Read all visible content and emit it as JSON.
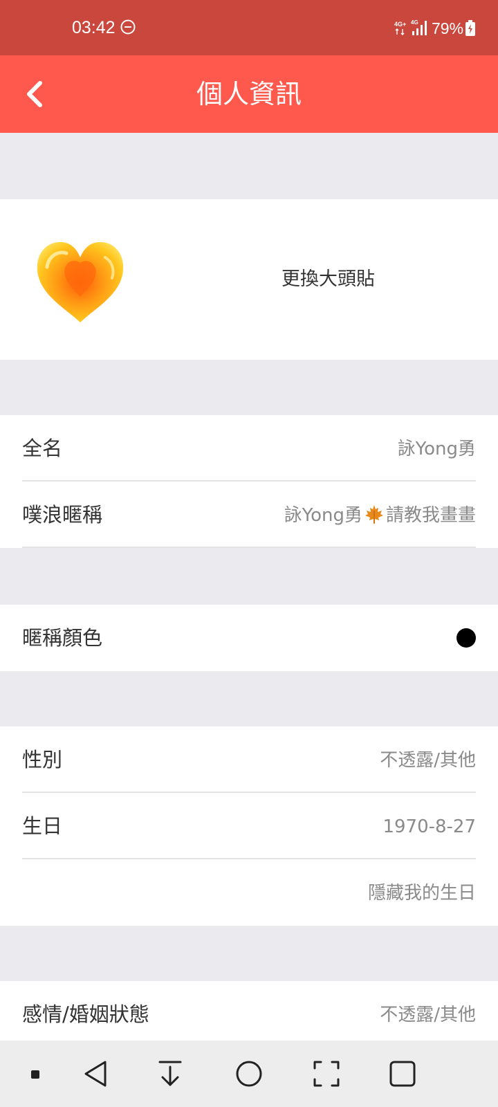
{
  "status_bar": {
    "time": "03:42",
    "network_badge": "4G+",
    "signal_badge": "4G",
    "battery_percent": "79%"
  },
  "header": {
    "title": "個人資訊",
    "background_color": "#ff584c"
  },
  "avatar_section": {
    "change_avatar_label": "更換大頭貼"
  },
  "name_section": {
    "full_name_label": "全名",
    "full_name_value": "詠Yong勇",
    "nickname_label": "噗浪暱稱",
    "nickname_value_part1": "詠Yong勇",
    "nickname_value_part2": "請教我畫畫"
  },
  "color_section": {
    "nickname_color_label": "暱稱顏色",
    "nickname_color": "#000000"
  },
  "personal_section": {
    "gender_label": "性別",
    "gender_value": "不透露/其他",
    "birthday_label": "生日",
    "birthday_value": "1970-8-27",
    "hide_birthday_label": "隱藏我的生日"
  },
  "relationship_section": {
    "relationship_label": "感情/婚姻狀態",
    "relationship_value": "不透露/其他"
  },
  "icons": {
    "back": "chevron-left-icon",
    "dnd": "do-not-disturb-icon",
    "avatar": "heart-icon",
    "nickname_emoji": "maple-leaf-icon"
  }
}
